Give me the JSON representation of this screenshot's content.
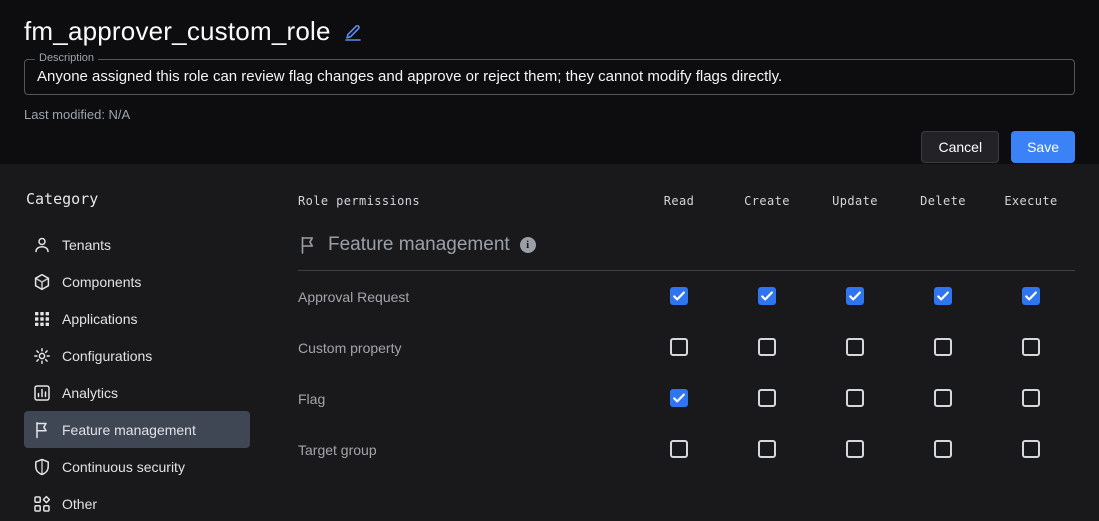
{
  "header": {
    "title": "fm_approver_custom_role",
    "description_label": "Description",
    "description_value": "Anyone assigned this role can review flag changes and approve or reject them; they cannot modify flags directly.",
    "last_modified": "Last modified: N/A",
    "cancel_label": "Cancel",
    "save_label": "Save"
  },
  "sidebar": {
    "heading": "Category",
    "items": [
      {
        "label": "Tenants",
        "icon": "person-icon",
        "selected": false
      },
      {
        "label": "Components",
        "icon": "component-icon",
        "selected": false
      },
      {
        "label": "Applications",
        "icon": "grid-icon",
        "selected": false
      },
      {
        "label": "Configurations",
        "icon": "gear-icon",
        "selected": false
      },
      {
        "label": "Analytics",
        "icon": "analytics-icon",
        "selected": false
      },
      {
        "label": "Feature management",
        "icon": "flag-icon",
        "selected": true
      },
      {
        "label": "Continuous security",
        "icon": "shield-icon",
        "selected": false
      },
      {
        "label": "Other",
        "icon": "category-icon",
        "selected": false
      }
    ]
  },
  "permissions": {
    "table_heading": "Role permissions",
    "columns": [
      "Read",
      "Create",
      "Update",
      "Delete",
      "Execute"
    ],
    "section_title": "Feature management",
    "rows": [
      {
        "label": "Approval Request",
        "checks": [
          true,
          true,
          true,
          true,
          true
        ]
      },
      {
        "label": "Custom property",
        "checks": [
          false,
          false,
          false,
          false,
          false
        ]
      },
      {
        "label": "Flag",
        "checks": [
          true,
          false,
          false,
          false,
          false
        ]
      },
      {
        "label": "Target group",
        "checks": [
          false,
          false,
          false,
          false,
          false
        ]
      }
    ]
  },
  "colors": {
    "accent_blue": "#3b82f6",
    "checkbox_checked": "#2f74f1",
    "selected_item_bg": "#3f4754",
    "header_bg": "#0d0d0f",
    "main_bg": "#19191c"
  }
}
